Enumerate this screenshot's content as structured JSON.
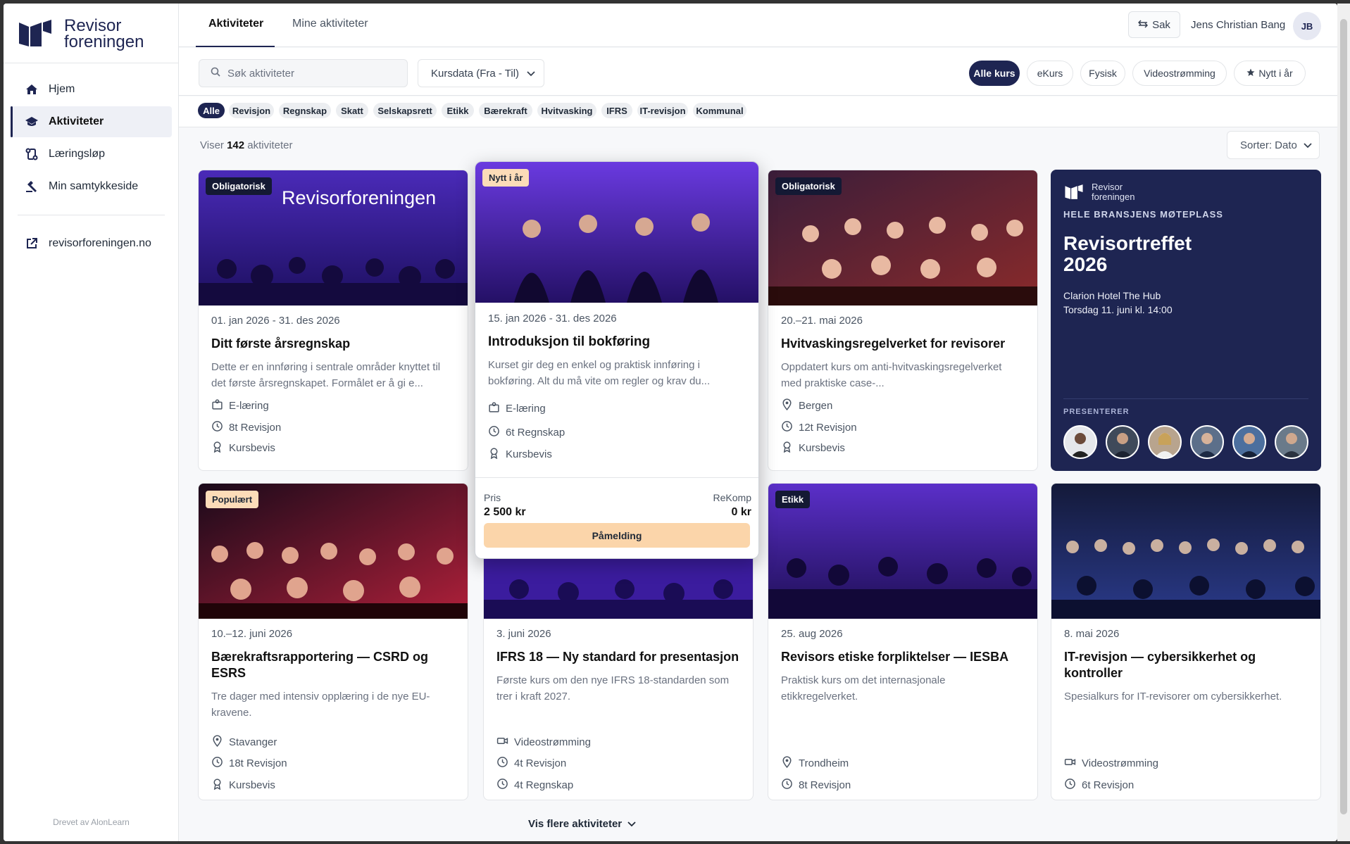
{
  "brand": {
    "line1": "Revisor",
    "line2": "foreningen",
    "color": "#1e2552"
  },
  "nav": {
    "items": [
      {
        "label": "Hjem",
        "icon": "home-icon"
      },
      {
        "label": "Aktiviteter",
        "icon": "graduation-cap-icon",
        "active": true
      },
      {
        "label": "Læringsløp",
        "icon": "route-icon"
      },
      {
        "label": "Min samtykkeside",
        "icon": "gavel-icon"
      }
    ],
    "external": {
      "label": "revisorforeningen.no",
      "icon": "external-link-icon"
    },
    "powered_by": "Drevet av AlonLearn"
  },
  "header": {
    "tabs": [
      {
        "label": "Aktiviteter",
        "active": true
      },
      {
        "label": "Mine aktiviteter"
      }
    ],
    "sak_label": "Sak",
    "user_name": "Jens Christian Bang",
    "user_initials": "JB"
  },
  "filters": {
    "search_placeholder": "Søk aktiviteter",
    "date_select": "Kursdata (Fra - Til)",
    "formats": [
      {
        "label": "Alle kurs",
        "active": true
      },
      {
        "label": "eKurs"
      },
      {
        "label": "Fysisk"
      },
      {
        "label": "Videostrømming"
      },
      {
        "label": "Nytt i år",
        "icon": "star-icon"
      }
    ],
    "categories": [
      {
        "label": "Alle",
        "active": true
      },
      {
        "label": "Revisjon"
      },
      {
        "label": "Regnskap"
      },
      {
        "label": "Skatt"
      },
      {
        "label": "Selskapsrett"
      },
      {
        "label": "Etikk"
      },
      {
        "label": "Bærekraft"
      },
      {
        "label": "Hvitvasking"
      },
      {
        "label": "IFRS"
      },
      {
        "label": "IT-revisjon"
      },
      {
        "label": "Kommunal"
      }
    ]
  },
  "results": {
    "prefix": "Viser",
    "count": "142",
    "suffix": "aktiviteter",
    "sort": "Sorter: Dato"
  },
  "cards": [
    {
      "badge": "Obligatorisk",
      "img_text": "Revisorforeningen",
      "date": "01. jan 2026 - 31. des 2026",
      "title": "Ditt første årsregnskap",
      "desc": "Dette er en innføring i sentrale områder knyttet til det første årsregnskapet. Formålet er å gi e...",
      "meta": [
        "E-læring",
        "8t Revisjon",
        "Kursbevis"
      ]
    },
    {
      "badge": "Nytt i år",
      "date": "15. jan 2026 - 31. des 2026",
      "title": "Introduksjon til bokføring",
      "desc": "Kurset gir deg en enkel og praktisk innføring i bokføring. Alt du må vite om regler og krav du...",
      "meta": [
        "E-læring",
        "6t Regnskap",
        "Kursbevis"
      ],
      "price_label": "Pris",
      "price": "2 500 kr",
      "rekomp_label": "ReKomp",
      "rekomp": "0 kr",
      "cta": "Påmelding"
    },
    {
      "badge": "Obligatorisk",
      "date": "20.–21. mai 2026",
      "title": "Hvitvaskingsregelverket for revisorer",
      "desc": "Oppdatert kurs om anti-hvitvaskingsregelverket med praktiske case-...",
      "meta": [
        "Bergen",
        "12t Revisjon",
        "Kursbevis"
      ]
    },
    {
      "badge": "Populært",
      "date": "10.–12. juni 2026",
      "title": "Bærekraftsrapportering — CSRD og ESRS",
      "desc": "Tre dager med intensiv opplæring i de nye EU-kravene.",
      "meta": [
        "Stavanger",
        "18t Revisjon",
        "Kursbevis"
      ]
    },
    {
      "date": "3. juni 2026",
      "title": "IFRS 18 — Ny standard for presentasjon",
      "desc": "Første kurs om den nye IFRS 18-standarden som trer i kraft 2027.",
      "meta": [
        "Videostrømming",
        "4t Revisjon",
        "4t Regnskap"
      ]
    },
    {
      "badge": "Etikk",
      "date": "25. aug 2026",
      "title": "Revisors etiske forpliktelser — IESBA",
      "desc": "Praktisk kurs om det internasjonale etikkregelverket.",
      "meta": [
        "Trondheim",
        "8t Revisjon"
      ]
    },
    {
      "date": "8. mai 2026",
      "title": "IT-revisjon — cybersikkerhet og kontroller",
      "desc": "Spesialkurs for IT-revisorer om cybersikkerhet.",
      "meta": [
        "Videostrømming",
        "6t Revisjon"
      ]
    }
  ],
  "featured": {
    "logo_line1": "Revisor",
    "logo_line2": "foreningen",
    "kicker": "HELE BRANSJENS MØTEPLASS",
    "title_line1": "Revisortreffet",
    "title_line2": "2026",
    "venue": "Clarion Hotel The Hub",
    "when": "Torsdag 11. juni kl. 14:00",
    "presents": "PRESENTERER",
    "presenters": 6
  },
  "more": "Vis flere aktiviteter",
  "colors": {
    "navy": "#1e2552",
    "peach": "#fbd5aa",
    "purple": "#5b2fc9"
  }
}
